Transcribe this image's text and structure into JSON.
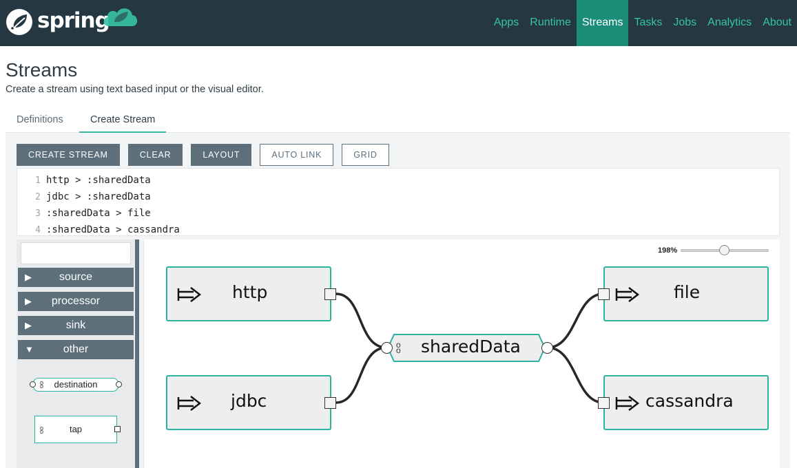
{
  "app": {
    "logo_text": "spring"
  },
  "nav": [
    {
      "label": "Apps",
      "active": false
    },
    {
      "label": "Runtime",
      "active": false
    },
    {
      "label": "Streams",
      "active": true
    },
    {
      "label": "Tasks",
      "active": false
    },
    {
      "label": "Jobs",
      "active": false
    },
    {
      "label": "Analytics",
      "active": false
    },
    {
      "label": "About",
      "active": false
    }
  ],
  "page": {
    "title": "Streams",
    "subtitle": "Create a stream using text based input or the visual editor."
  },
  "tabs": [
    {
      "label": "Definitions",
      "active": false
    },
    {
      "label": "Create Stream",
      "active": true
    }
  ],
  "toolbar": {
    "create_stream": "CREATE STREAM",
    "clear": "CLEAR",
    "layout": "LAYOUT",
    "auto_link": "AUTO LINK",
    "grid": "GRID"
  },
  "editor": {
    "lines": [
      {
        "num": "1",
        "code": "http > :sharedData"
      },
      {
        "num": "2",
        "code": "jdbc > :sharedData"
      },
      {
        "num": "3",
        "code": ":sharedData > file"
      },
      {
        "num": "4",
        "code": ":sharedData > cassandra"
      }
    ]
  },
  "palette": {
    "search_value": "",
    "groups": [
      {
        "label": "source",
        "expanded": false
      },
      {
        "label": "processor",
        "expanded": false
      },
      {
        "label": "sink",
        "expanded": false
      },
      {
        "label": "other",
        "expanded": true
      }
    ],
    "items": {
      "destination": "destination",
      "tap": "tap"
    }
  },
  "canvas": {
    "zoom": "198%",
    "zoom_level": 198,
    "nodes": {
      "http": "http",
      "jdbc": "jdbc",
      "shared": "sharedData",
      "file": "file",
      "cassandra": "cassandra"
    }
  },
  "colors": {
    "topbar": "#243743",
    "accent": "#35c4a6",
    "active_nav": "#1b8c77",
    "node_border": "#2bb3a1",
    "button": "#5d6f7b"
  },
  "icons": [
    "spring-leaf-icon",
    "cloud-icon",
    "source-arrow-icon",
    "triangle-right-icon",
    "triangle-down-icon"
  ]
}
